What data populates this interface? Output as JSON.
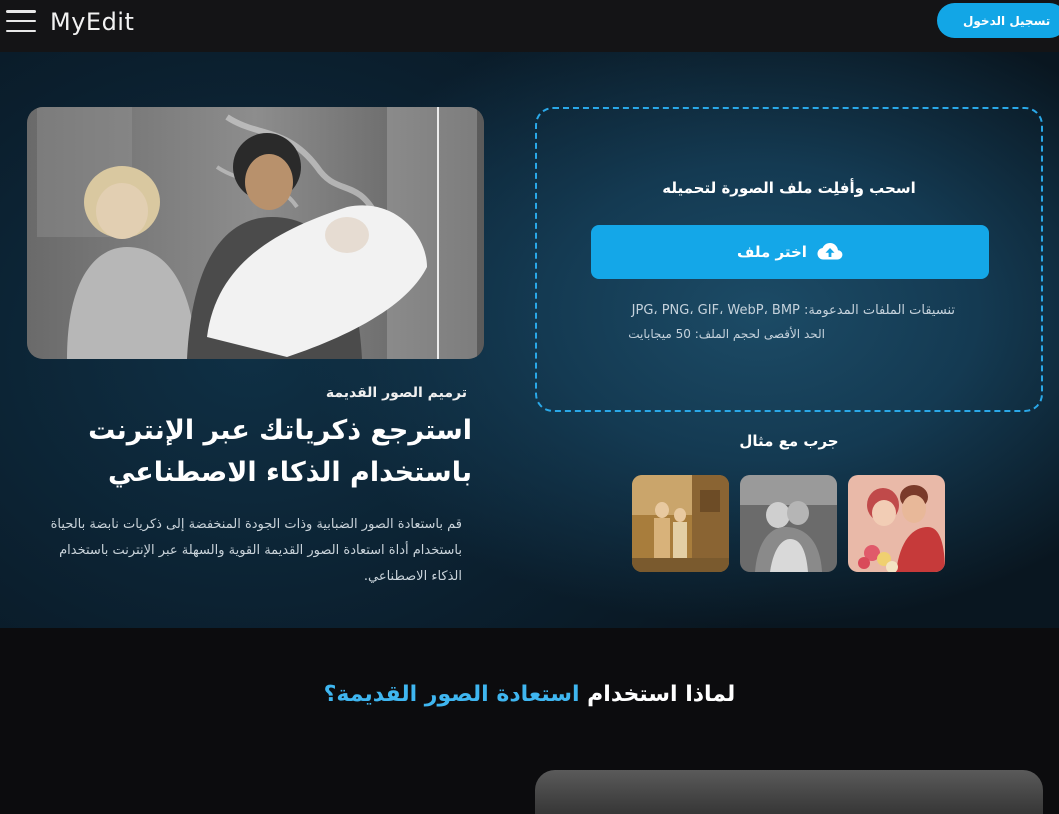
{
  "header": {
    "logo": "MyEdit",
    "login_label": "تسجيل الدخول"
  },
  "hero": {
    "tag": "ترميم الصور القديمة",
    "title": "استرجع ذكرياتك عبر الإنترنت باستخدام الذكاء الاصطناعي",
    "description": "قم باستعادة الصور الضبابية وذات الجودة المنخفضة إلى ذكريات نابضة بالحياة باستخدام أداة استعادة الصور القديمة القوية والسهلة عبر الإنترنت باستخدام الذكاء الاصطناعي."
  },
  "upload": {
    "prompt": "اسحب وأفلِت ملف الصورة لتحميله",
    "button_label": "اختر ملف",
    "formats": "تنسيقات الملفات المدعومة: JPG، PNG، GIF، WebP، BMP",
    "max_size": "الحد الأقصى لحجم الملف: 50 ميجابايت"
  },
  "examples": {
    "label": "جرب مع مثال"
  },
  "why": {
    "title_plain": "لماذا استخدام",
    "title_accent": "استعادة الصور القديمة؟"
  },
  "colors": {
    "accent": "#14a7e8",
    "header_bg": "#141416",
    "hero_bg": "#0f3045"
  },
  "icons": [
    "menu-icon",
    "cloud-upload-icon"
  ]
}
